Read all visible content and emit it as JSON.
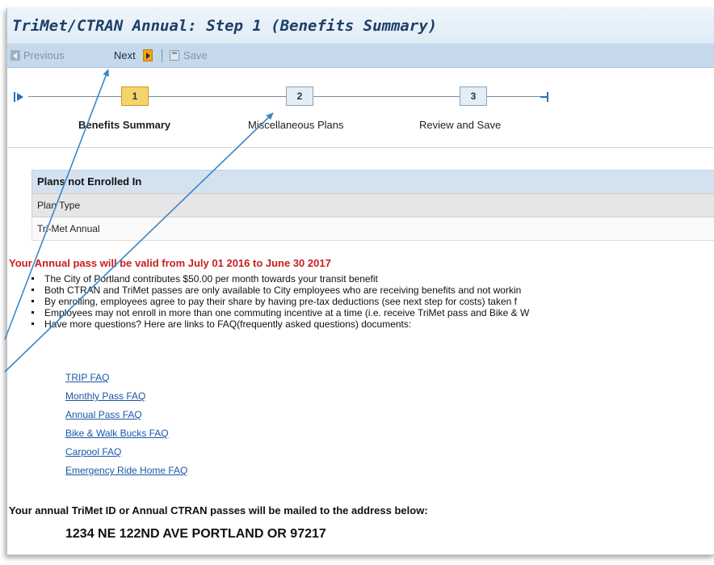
{
  "window": {
    "title": "TriMet/CTRAN Annual: Step 1  (Benefits Summary)"
  },
  "toolbar": {
    "previous_label": "Previous",
    "next_label": "Next",
    "save_label": "Save",
    "icons": {
      "previous": "arrow-left-icon",
      "next": "arrow-right-icon",
      "save": "save-icon"
    },
    "accent": "#f3a315"
  },
  "roadmap": {
    "steps": [
      {
        "number": "1",
        "label": "Benefits Summary",
        "active": true
      },
      {
        "number": "2",
        "label": "Miscellaneous Plans",
        "active": false
      },
      {
        "number": "3",
        "label": "Review and Save",
        "active": false
      }
    ],
    "colors": {
      "active": "#f6d36b",
      "inactive": "#e4edf6",
      "connector": "#2a6fb0"
    }
  },
  "plans_table": {
    "heading": "Plans not Enrolled In",
    "column_header": "Plan Type",
    "rows": [
      "Tri-Met Annual"
    ]
  },
  "notice": {
    "validity": "Your Annual pass will be valid from July 01 2016 to June 30 2017",
    "color": "#c61f1f",
    "bullets": [
      "The City of Portland contributes $50.00 per month towards your transit benefit",
      "Both CTRAN and TriMet passes are only available to City employees who are receiving benefits and not workin",
      "By enrolling, employees agree to pay their share by having pre-tax deductions (see next step for costs) taken f",
      "Employees may not enroll in more than one commuting incentive at a time (i.e. receive TriMet pass and Bike & W",
      "Have more questions? Here are links to FAQ(frequently asked questions) documents:"
    ]
  },
  "faq_links": [
    "TRIP FAQ",
    "Monthly Pass FAQ",
    "Annual Pass FAQ",
    "Bike & Walk Bucks FAQ",
    "Carpool FAQ",
    "Emergency Ride Home FAQ"
  ],
  "mailing": {
    "note": "Your annual TriMet ID or Annual CTRAN passes will be mailed to the address below:",
    "address": "1234 NE 122ND AVE PORTLAND OR 97217"
  },
  "annotation": {
    "arrow_color": "#3d86c6"
  }
}
